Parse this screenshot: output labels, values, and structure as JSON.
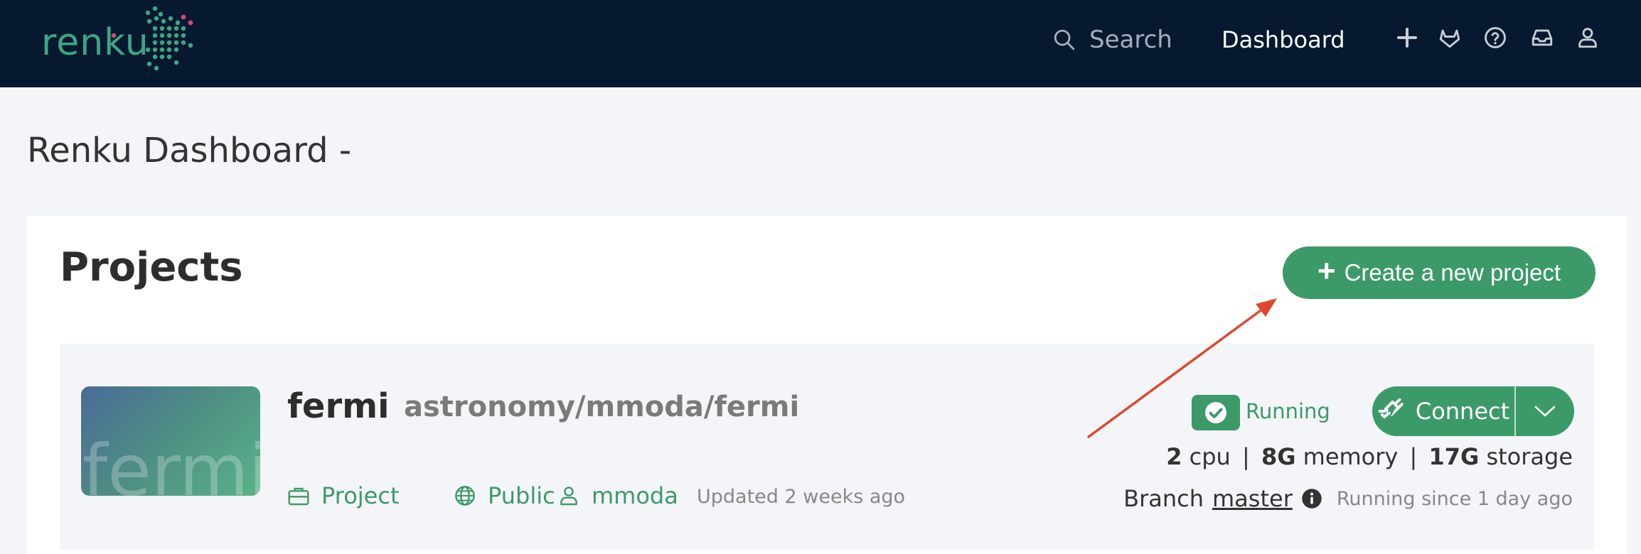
{
  "navbar": {
    "logo_text": "renku",
    "search_label": "Search",
    "dashboard_label": "Dashboard",
    "icons": [
      "plus-icon",
      "gitlab-icon",
      "help-icon",
      "inbox-icon",
      "user-icon"
    ]
  },
  "page": {
    "title": "Renku Dashboard - "
  },
  "projects": {
    "heading": "Projects",
    "create_label": "Create a new project",
    "items": [
      {
        "thumbnail_text": "fermi",
        "name": "fermi",
        "path": "astronomy/mmoda/fermi",
        "type": "Project",
        "visibility": "Public",
        "owner": "mmoda",
        "updated": "Updated 2 weeks ago",
        "status": "Running",
        "connect_label": "Connect",
        "cpu_value": "2",
        "cpu_unit": "cpu",
        "memory_value": "8G",
        "memory_unit": "memory",
        "storage_value": "17G",
        "storage_unit": "storage",
        "branch_label": "Branch",
        "branch_name": "master",
        "running_since": "Running since 1 day ago"
      }
    ]
  },
  "colors": {
    "navbar_bg": "#061930",
    "accent_green": "#3c9a69",
    "annotation_arrow": "#e0462d"
  }
}
